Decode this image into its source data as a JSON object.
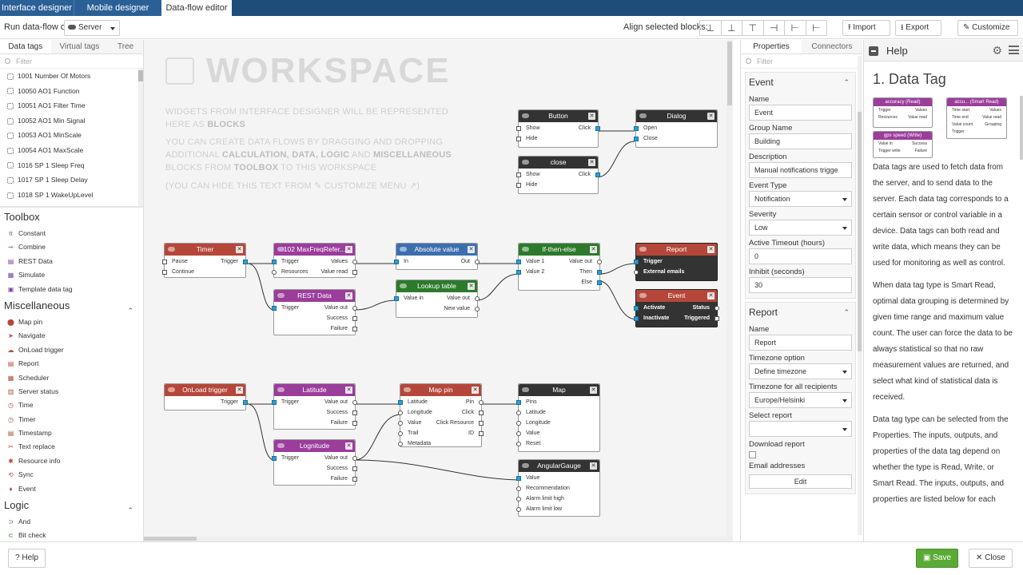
{
  "tabs": [
    "Interface designer",
    "Mobile designer",
    "Data-flow editor"
  ],
  "toolbar": {
    "run_label": "Run data-flow on",
    "server": "Server",
    "align_label": "Align selected blocks:",
    "align_buttons": [
      "⊥",
      "⊥",
      "⊤",
      "⊣",
      "⊢",
      "⊢"
    ],
    "import": "Import",
    "export": "Export",
    "customize": "Customize"
  },
  "left": {
    "tabs": [
      "Data tags",
      "Virtual tags",
      "Tree"
    ],
    "filter_placeholder": "Filter",
    "data_tags": [
      "1001 Number Of Motors",
      "10050 AO1 Function",
      "10051 AO1 Filter Time",
      "10052 AO1 Min Signal",
      "10053 AO1 MinScale",
      "10054 AO1 MaxScale",
      "1016 SP 1 Sleep Freq",
      "1017 SP 1 Sleep Delay",
      "1018 SP 1 WakeUpLevel"
    ],
    "toolbox_title": "Toolbox",
    "toolbox": [
      "Constant",
      "Combine",
      "REST Data",
      "Simulate",
      "Template data tag"
    ],
    "misc_title": "Miscellaneous",
    "misc": [
      "Map pin",
      "Navigate",
      "OnLoad trigger",
      "Report",
      "Scheduler",
      "Server status",
      "Time",
      "Timer",
      "Timestamp",
      "Text replace",
      "Resource info",
      "Sync",
      "Event"
    ],
    "logic_title": "Logic",
    "logic": [
      "And",
      "Bit check"
    ]
  },
  "workspace": {
    "title": "WORKSPACE",
    "line1": "WIDGETS FROM INTERFACE DESIGNER WILL BE REPRESENTED",
    "line2a": "HERE AS ",
    "line2b": "BLOCKS",
    "line3": "YOU CAN CREATE DATA FLOWS BY DRAGGING AND DROPPING",
    "line4a": "ADDITIONAL ",
    "line4b": "CALCULATION, DATA, LOGIC",
    "line4c": " AND ",
    "line4d": "MISCELLANEOUS",
    "line5a": "BLOCKS FROM ",
    "line5b": "TOOLBOX",
    "line5c": " TO THIS WORKSPACE",
    "line6": "(YOU CAN HIDE THIS TEXT FROM ✎ CUSTOMIZE MENU ↗)"
  },
  "blocks": {
    "button": {
      "title": "Button",
      "inputs": [
        "Show",
        "Hide"
      ],
      "outputs": [
        "Click"
      ]
    },
    "dialog": {
      "title": "Dialog",
      "inputs": [
        "Open",
        "Close"
      ]
    },
    "close": {
      "title": "close",
      "inputs": [
        "Show",
        "Hide"
      ],
      "outputs": [
        "Click"
      ]
    },
    "timer": {
      "title": "Timer",
      "inputs": [
        "Pause",
        "Continue"
      ],
      "outputs": [
        "Trigger"
      ]
    },
    "maxfreq": {
      "title": "102 MaxFreqRefer...",
      "inputs": [
        "Trigger",
        "Resources"
      ],
      "outputs": [
        "Values",
        "Value read"
      ]
    },
    "absolute": {
      "title": "Absolute value",
      "inputs": [
        "In"
      ],
      "outputs": [
        "Out"
      ]
    },
    "ifthen": {
      "title": "If-then-else",
      "inputs": [
        "Value 1",
        "Value 2"
      ],
      "outputs": [
        "Value out",
        "Then",
        "Else"
      ]
    },
    "report": {
      "title": "Report",
      "inputs": [
        "Trigger",
        "External emails"
      ]
    },
    "restdata": {
      "title": "REST Data",
      "inputs": [
        "Trigger"
      ],
      "outputs": [
        "Value out",
        "Success",
        "Failure"
      ]
    },
    "lookup": {
      "title": "Lookup table",
      "inputs": [
        "Value in"
      ],
      "outputs": [
        "Value out",
        "New value"
      ]
    },
    "event": {
      "title": "Event",
      "inputs": [
        "Activate",
        "Inactivate"
      ],
      "outputs": [
        "Status",
        "Triggered"
      ]
    },
    "onload": {
      "title": "OnLoad trigger",
      "outputs": [
        "Trigger"
      ]
    },
    "latitude": {
      "title": "Latitude",
      "inputs": [
        "Trigger"
      ],
      "outputs": [
        "Value out",
        "Success",
        "Failure"
      ]
    },
    "mappin": {
      "title": "Map pin",
      "inputs": [
        "Latitude",
        "Longitude",
        "Value",
        "Trail",
        "Metadata"
      ],
      "outputs": [
        "Pin",
        "Click",
        "Click Resource",
        "ID"
      ]
    },
    "map": {
      "title": "Map",
      "inputs": [
        "Pins",
        "Latitude",
        "Longitude",
        "Value",
        "Reset"
      ]
    },
    "lognitude": {
      "title": "Lognitude",
      "inputs": [
        "Trigger"
      ],
      "outputs": [
        "Value out",
        "Success",
        "Failure"
      ]
    },
    "gauge": {
      "title": "AngularGauge",
      "inputs": [
        "Value",
        "Recommendation",
        "Alarm limit high",
        "Alarm limit low"
      ]
    }
  },
  "props": {
    "tabs": [
      "Properties",
      "Connectors"
    ],
    "filter_placeholder": "Filter",
    "event_group": {
      "title": "Event",
      "fields": [
        {
          "label": "Name",
          "value": "Event",
          "type": "text"
        },
        {
          "label": "Group Name",
          "value": "Building",
          "type": "text"
        },
        {
          "label": "Description",
          "value": "Manual notifications trigge",
          "type": "text"
        },
        {
          "label": "Event Type",
          "value": "Notification",
          "type": "select"
        },
        {
          "label": "Severity",
          "value": "Low",
          "type": "select"
        },
        {
          "label": "Active Timeout (hours)",
          "value": "0",
          "type": "text"
        },
        {
          "label": "Inhibit (seconds)",
          "value": "30",
          "type": "text"
        }
      ]
    },
    "report_group": {
      "title": "Report",
      "fields": [
        {
          "label": "Name",
          "value": "Report",
          "type": "text"
        },
        {
          "label": "Timezone option",
          "value": "Define timezone",
          "type": "select"
        },
        {
          "label": "Timezone for all recipients",
          "value": "Europe/Helsinki",
          "type": "select"
        },
        {
          "label": "Select report",
          "value": "",
          "type": "select"
        }
      ],
      "download_label": "Download report",
      "email_label": "Email addresses",
      "edit_button": "Edit"
    }
  },
  "help": {
    "title": "Help",
    "heading": "1. Data Tag",
    "mini_blocks": {
      "read": {
        "title": "accuracy (Read)",
        "inputs": [
          "Trigger",
          "Resources"
        ],
        "outputs": [
          "Values",
          "Value read"
        ]
      },
      "smart": {
        "title": "accu... (Smart Read)",
        "inputs": [
          "Time start",
          "Time end",
          "Value count",
          "Trigger"
        ],
        "outputs": [
          "Values",
          "Value read",
          "Grouping"
        ]
      },
      "write": {
        "title": "gps speed (Write)",
        "inputs": [
          "Value in",
          "Trigger write"
        ],
        "outputs": [
          "Success",
          "Failure"
        ]
      }
    },
    "paragraphs": [
      "Data tags are used to fetch data from the server, and to send data to the server. Each data tag corresponds to a certain sensor or control variable in a device. Data tags can both read and write data, which means they can be used for monitoring as well as control.",
      "When data tag type is Smart Read, optimal data grouping is determined by given time range and maximum value count. The user can force the data to be always statistical so that no raw measurement values are returned, and select what kind of statistical data is received.",
      "Data tag type can be selected from the Properties. The inputs, outputs, and properties of the data tag depend on whether the type is Read, Write, or Smart Read. The inputs, outputs, and properties are listed below for each"
    ]
  },
  "footer": {
    "help": "Help",
    "save": "Save",
    "close": "Close"
  }
}
